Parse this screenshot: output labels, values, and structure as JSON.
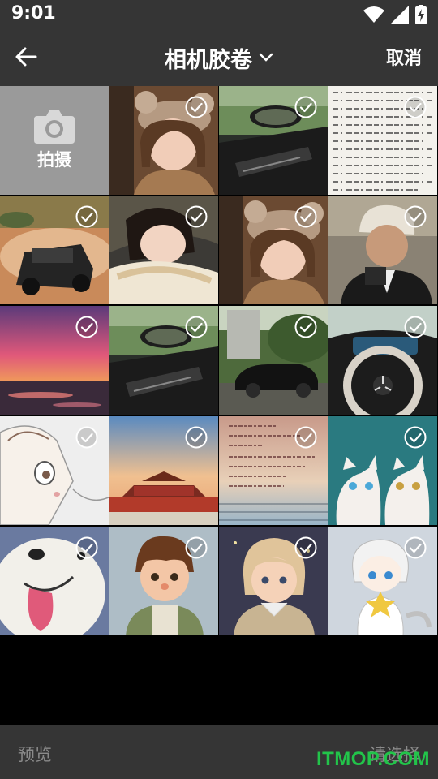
{
  "status_bar": {
    "time": "9:01",
    "icons": [
      "wifi-icon",
      "signal-icon",
      "battery-charging-icon"
    ]
  },
  "header": {
    "title": "相机胶卷",
    "cancel_label": "取消"
  },
  "camera_tile": {
    "label": "拍摄"
  },
  "photos": [
    {
      "subject": "girl in bear hat",
      "selected": false
    },
    {
      "subject": "car interior with mirror",
      "selected": false
    },
    {
      "subject": "handwritten document",
      "selected": false
    },
    {
      "subject": "off-road vehicle in desert",
      "selected": false
    },
    {
      "subject": "woman lying on pillow",
      "selected": false
    },
    {
      "subject": "girl in bear hat",
      "selected": false
    },
    {
      "subject": "man with beanie and camera",
      "selected": false
    },
    {
      "subject": "sunset over the sea",
      "selected": false
    },
    {
      "subject": "car interior with mirror",
      "selected": false
    },
    {
      "subject": "black sedan in park",
      "selected": false
    },
    {
      "subject": "car steering wheel",
      "selected": false
    },
    {
      "subject": "anime girl sketch",
      "selected": false
    },
    {
      "subject": "Forbidden City at sunset",
      "selected": false
    },
    {
      "subject": "text note on sky background",
      "selected": false
    },
    {
      "subject": "two white kittens",
      "selected": false
    },
    {
      "subject": "white puppy",
      "selected": false
    },
    {
      "subject": "cartoon boy",
      "selected": false
    },
    {
      "subject": "cartoon girl",
      "selected": false
    },
    {
      "subject": "chibi boy holding star",
      "selected": false
    }
  ],
  "footer": {
    "preview_label": "预览",
    "select_hint": "请选择",
    "watermark": "ITMOP.COM"
  }
}
